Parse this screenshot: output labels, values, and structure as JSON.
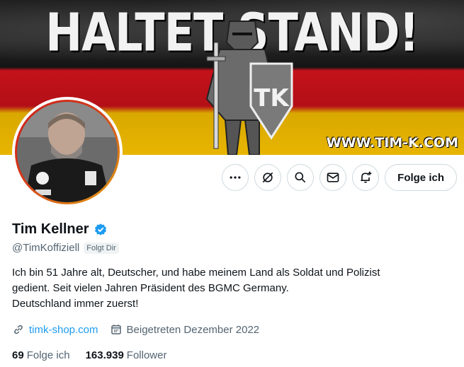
{
  "banner": {
    "title": "HALTET STAND!",
    "url_text": "WWW.TIM-K.COM",
    "emblem_text": "TK"
  },
  "profile": {
    "name": "Tim Kellner",
    "handle": "@TimKoffiziell",
    "follows_badge": "Folgt Dir",
    "verified": true,
    "bio_lines": [
      "Ich bin 51 Jahre alt, Deutscher, und habe meinem Land als Soldat und Polizist",
      "gedient. Seit vielen Jahren Präsident des BGMC Germany.",
      "Deutschland immer zuerst!"
    ],
    "website": "timk-shop.com",
    "joined": "Beigetreten Dezember 2022"
  },
  "stats": {
    "following_count": "69",
    "following_label": "Folge ich",
    "followers_count": "163.939",
    "followers_label": "Follower"
  },
  "actions": {
    "follow_label": "Folge ich",
    "icons": [
      "more-icon",
      "grok-icon",
      "search-icon",
      "message-icon",
      "notify-icon"
    ]
  },
  "colors": {
    "accent": "#1d9bf0",
    "text": "#0f1419",
    "secondary": "#536471",
    "border": "#cfd9de",
    "banner_red": "#c4121a",
    "banner_gold": "#e7b500"
  }
}
